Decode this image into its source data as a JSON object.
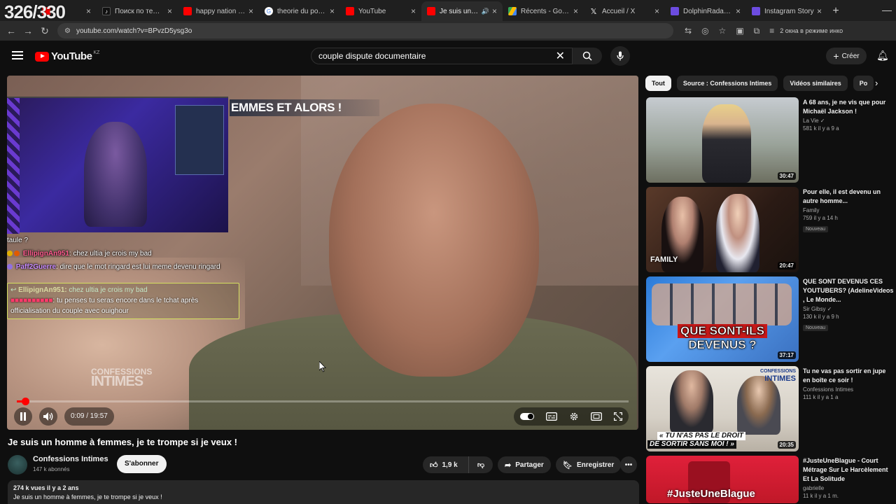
{
  "overlay": {
    "counter": "326/330"
  },
  "browser": {
    "tabs": [
      {
        "label": "",
        "color": "#ff0000"
      },
      {
        "label": "Поиск по теме -",
        "color": "#111111"
      },
      {
        "label": "happy nation vib",
        "color": "#ff0000"
      },
      {
        "label": "theorie du pot de",
        "color": "#4285f4"
      },
      {
        "label": "YouTube",
        "color": "#ff0000"
      },
      {
        "label": "Je suis un hom",
        "color": "#ff0000",
        "active": true
      },
      {
        "label": "Récents - Google",
        "color": "#34a853"
      },
      {
        "label": "Accueil / X",
        "color": "#000000"
      },
      {
        "label": "DolphinRadar - Y",
        "color": "#6c4ce0"
      },
      {
        "label": "Instagram Story",
        "color": "#6c4ce0"
      }
    ],
    "url": "youtube.com/watch?v=BPvzD5ysg3o",
    "profile_text": "2 окна в режиме инко"
  },
  "header": {
    "logo_text": "YouTube",
    "country_code": "KZ",
    "search_value": "couple dispute documentaire",
    "create_label": "Créer"
  },
  "player": {
    "banner_text": "EMMES ET ALORS !",
    "watermark_top": "CONFESSIONS",
    "watermark_bottom": "INTIMES",
    "time_label": "0:09 / 19:57",
    "progress": 0.008,
    "chat": {
      "line0": "taule ?",
      "line1_user": "EllipignAn951",
      "line1_msg": ": chez ultia je crois my bad",
      "line2_user": "Paff2Guerre",
      "line2_msg": ": dire que le mot ringard est lui meme devenu ringard",
      "reply_ref_user": "EllipignAn951:",
      "reply_ref_msg": " chez ultia je crois my bad",
      "reply_msg": ": tu penses tu seras encore dans le tchat après officialisation du couple avec ouighour"
    }
  },
  "video": {
    "title": "Je suis un homme à femmes, je te trompe si je veux !",
    "channel": "Confessions Intimes",
    "subscribers": "147 k abonnés",
    "subscribe_label": "S'abonner",
    "likes": "1,9 k",
    "share_label": "Partager",
    "save_label": "Enregistrer",
    "views_date": "274 k vues  il y a 2 ans",
    "description": "Je suis un homme à femmes, je te trompe si je veux !"
  },
  "sidebar": {
    "chips": [
      "Tout",
      "Source : Confessions Intimes",
      "Vidéos similaires",
      "Po"
    ],
    "recommendations": [
      {
        "title": "A 68 ans, je ne vis que pour Michaël Jackson !",
        "channel": "La Vie ✓",
        "meta": "581 k  il y a 9 a",
        "duration": "30:47",
        "badge": ""
      },
      {
        "title": "Pour elle, il est devenu un autre homme...",
        "channel": "Family",
        "meta": "759  il y a 14 h",
        "duration": "20:47",
        "badge": "Nouveau"
      },
      {
        "title": "QUE SONT DEVENUS CES YOUTUBERS? (AdelineVideos , Le Monde...",
        "channel": "Sir Gibsy ✓",
        "meta": "130 k  il y a 9 h",
        "duration": "37:17",
        "badge": "Nouveau"
      },
      {
        "title": "Tu ne vas pas sortir en jupe en boîte ce soir !",
        "channel": "Confessions Intimes",
        "meta": "111 k  il y a 1 a",
        "duration": "20:35",
        "badge": ""
      },
      {
        "title": "#JusteUneBlague - Court Métrage Sur Le Harcèlement Et La Solitude",
        "channel": "gabrielle",
        "meta": "11 k  il y a 1 m.",
        "duration": "",
        "badge": ""
      }
    ],
    "thumb_texts": {
      "family": "FAMILY",
      "devenus_1": "QUE SONT-ILS",
      "devenus_2": "DEVENUS ?",
      "jupe_1": "« TU N'AS PAS LE DROIT",
      "jupe_2": "DE SORTIR SANS MOI ! »",
      "jupe_logo_1": "CONFESSIONS",
      "jupe_logo_2": "INTIMES",
      "blague": "#JusteUneBlague"
    }
  },
  "colors": {
    "yt_red": "#ff0000",
    "bg": "#0f0f0f",
    "chip_bg": "#272727"
  }
}
